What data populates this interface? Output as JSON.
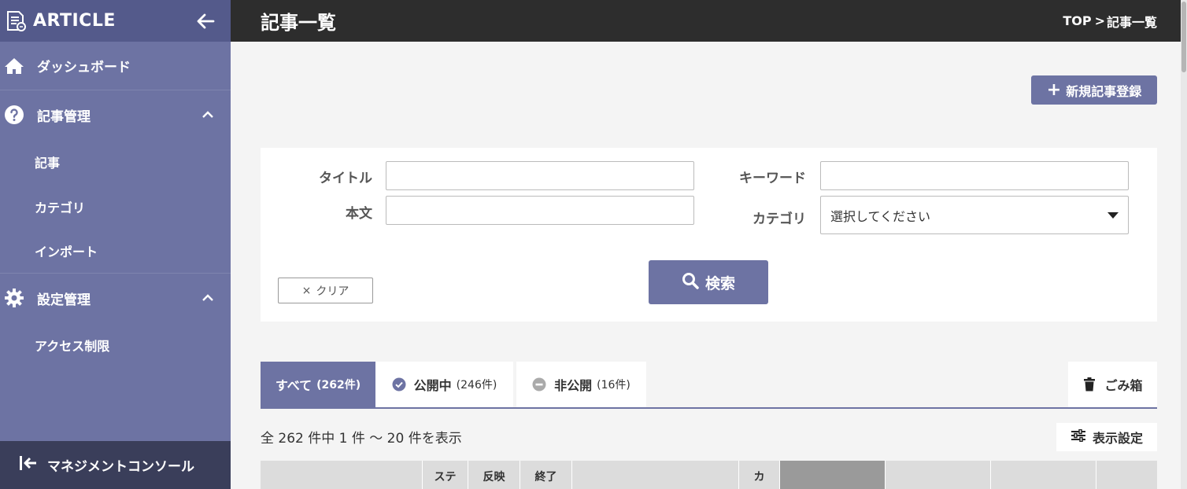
{
  "app": {
    "name": "ARTICLE"
  },
  "sidebar": {
    "items": [
      {
        "label": "ダッシュボード"
      },
      {
        "label": "記事管理",
        "children": [
          {
            "label": "記事"
          },
          {
            "label": "カテゴリ"
          },
          {
            "label": "インポート"
          }
        ]
      },
      {
        "label": "設定管理",
        "children": [
          {
            "label": "アクセス制限"
          }
        ]
      }
    ],
    "footer": {
      "label": "マネジメントコンソール"
    }
  },
  "header": {
    "title": "記事一覧",
    "breadcrumb": {
      "home": "TOP",
      "separator": ">",
      "current": "記事一覧"
    }
  },
  "actions": {
    "new_article": "新規記事登録"
  },
  "search": {
    "title_label": "タイトル",
    "title_value": "",
    "body_label": "本文",
    "body_value": "",
    "keyword_label": "キーワード",
    "keyword_value": "",
    "category_label": "カテゴリ",
    "category_selected": "選択してください",
    "search_button": "検索",
    "clear_button": "クリア"
  },
  "tabs": [
    {
      "label": "すべて",
      "count": "(262件)",
      "active": true
    },
    {
      "label": "公開中",
      "count": "(246件)",
      "icon": "check-circle-icon"
    },
    {
      "label": "非公開",
      "count": "(16件)",
      "icon": "minus-circle-icon"
    }
  ],
  "trash": {
    "label": "ごみ箱"
  },
  "summary": {
    "text": "全 262 件中 1 件 ～ 20 件を表示"
  },
  "display_settings": {
    "label": "表示設定"
  },
  "table": {
    "headers": [
      "",
      "ステ",
      "反映",
      "終了",
      "",
      "カ",
      "",
      "",
      "",
      "",
      ""
    ]
  },
  "colors": {
    "accent": "#6d73a3",
    "sidebar": "#6d73a3",
    "header": "#2d2d2d",
    "footer": "#3a3e5a"
  }
}
